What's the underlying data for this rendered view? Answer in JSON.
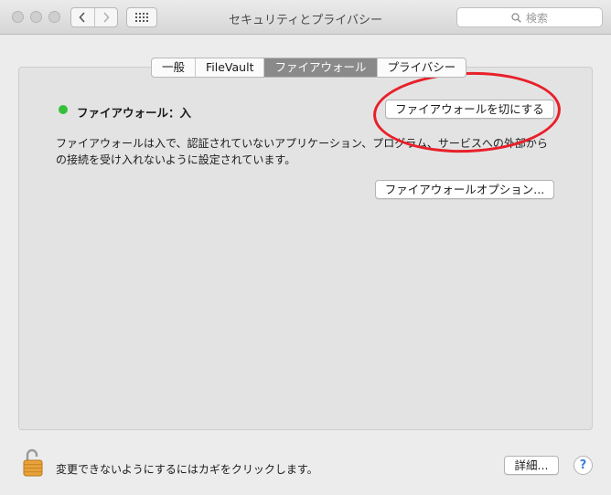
{
  "window": {
    "title": "セキュリティとプライバシー",
    "search_placeholder": "検索"
  },
  "tabs": [
    {
      "label": "一般",
      "selected": false
    },
    {
      "label": "FileVault",
      "selected": false
    },
    {
      "label": "ファイアウォール",
      "selected": true
    },
    {
      "label": "プライバシー",
      "selected": false
    }
  ],
  "firewall": {
    "status": "ファイアウォール：入",
    "status_color": "#33c13a",
    "toggle_button": "ファイアウォールを切にする",
    "description": "ファイアウォールは入で、認証されていないアプリケーション、プログラム、サービスへの外部からの接続を受け入れないように設定されています。",
    "options_button": "ファイアウォールオプション..."
  },
  "footer": {
    "lock_text": "変更できないようにするにはカギをクリックします。",
    "details_button": "詳細...",
    "help_label": "?"
  },
  "annotation_color": "#e8202a"
}
